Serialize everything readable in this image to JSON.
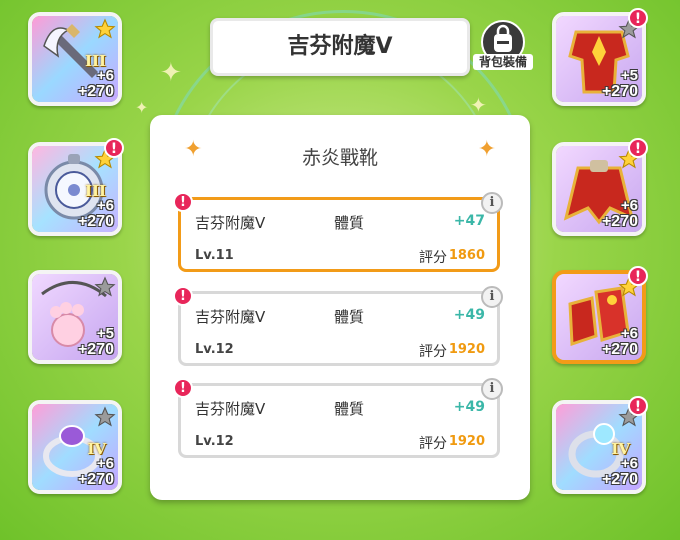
{
  "title": "吉芬附魔Ⅴ",
  "bag_button": {
    "label": "背包裝備",
    "icon": "backpack-icon"
  },
  "panel": {
    "title": "赤炎戰靴"
  },
  "enchant_cards": [
    {
      "name": "吉芬附魔Ⅴ",
      "stat": "體質",
      "bonus": "+47",
      "level": "Lv.11",
      "score_label": "評分",
      "score": "1860",
      "selected": true,
      "alert": "!",
      "info": "i"
    },
    {
      "name": "吉芬附魔Ⅴ",
      "stat": "體質",
      "bonus": "+49",
      "level": "Lv.12",
      "score_label": "評分",
      "score": "1920",
      "selected": false,
      "alert": "!",
      "info": "i"
    },
    {
      "name": "吉芬附魔Ⅴ",
      "stat": "體質",
      "bonus": "+49",
      "level": "Lv.12",
      "score_label": "評分",
      "score": "1920",
      "selected": false,
      "alert": "!",
      "info": "i"
    }
  ],
  "left_slots": [
    {
      "item": "crystal-axe-weapon",
      "rank": "III",
      "plus": "+6",
      "value": "+270",
      "star": "gold",
      "alert": ""
    },
    {
      "item": "crystal-badge-accessory",
      "rank": "III",
      "plus": "+6",
      "value": "+270",
      "star": "gold",
      "alert": "!"
    },
    {
      "item": "paw-pendant-necklace",
      "rank": "",
      "plus": "+5",
      "value": "+270",
      "star": "gray",
      "alert": ""
    },
    {
      "item": "amethyst-ring",
      "rank": "IV",
      "plus": "+6",
      "value": "+270",
      "star": "gray",
      "alert": ""
    }
  ],
  "right_slots": [
    {
      "item": "red-armor-chest",
      "rank": "",
      "plus": "+5",
      "value": "+270",
      "star": "gray",
      "alert": "!"
    },
    {
      "item": "red-cape",
      "rank": "",
      "plus": "+6",
      "value": "+270",
      "star": "gold",
      "alert": "!"
    },
    {
      "item": "red-boots",
      "rank": "",
      "plus": "+6",
      "value": "+270",
      "star": "gold",
      "alert": "!",
      "selected": true
    },
    {
      "item": "crystal-ring",
      "rank": "IV",
      "plus": "+6",
      "value": "+270",
      "star": "gray",
      "alert": "!"
    }
  ],
  "colors": {
    "accent": "#f29b18",
    "alert": "#e8265a",
    "bonus": "#3bb7a8",
    "score": "#f09a10"
  }
}
